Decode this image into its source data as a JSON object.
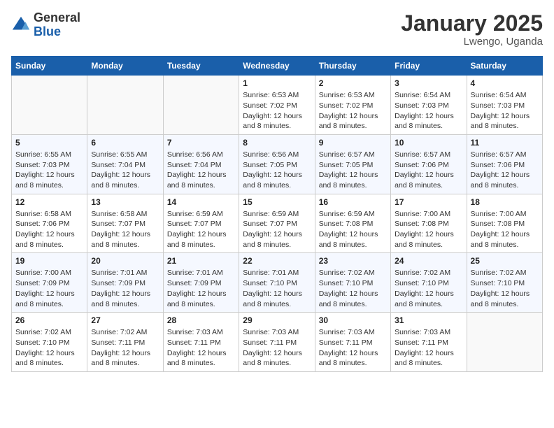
{
  "logo": {
    "general": "General",
    "blue": "Blue"
  },
  "header": {
    "month": "January 2025",
    "location": "Lwengo, Uganda"
  },
  "weekdays": [
    "Sunday",
    "Monday",
    "Tuesday",
    "Wednesday",
    "Thursday",
    "Friday",
    "Saturday"
  ],
  "weeks": [
    [
      {
        "day": "",
        "info": ""
      },
      {
        "day": "",
        "info": ""
      },
      {
        "day": "",
        "info": ""
      },
      {
        "day": "1",
        "info": "Sunrise: 6:53 AM\nSunset: 7:02 PM\nDaylight: 12 hours\nand 8 minutes."
      },
      {
        "day": "2",
        "info": "Sunrise: 6:53 AM\nSunset: 7:02 PM\nDaylight: 12 hours\nand 8 minutes."
      },
      {
        "day": "3",
        "info": "Sunrise: 6:54 AM\nSunset: 7:03 PM\nDaylight: 12 hours\nand 8 minutes."
      },
      {
        "day": "4",
        "info": "Sunrise: 6:54 AM\nSunset: 7:03 PM\nDaylight: 12 hours\nand 8 minutes."
      }
    ],
    [
      {
        "day": "5",
        "info": "Sunrise: 6:55 AM\nSunset: 7:03 PM\nDaylight: 12 hours\nand 8 minutes."
      },
      {
        "day": "6",
        "info": "Sunrise: 6:55 AM\nSunset: 7:04 PM\nDaylight: 12 hours\nand 8 minutes."
      },
      {
        "day": "7",
        "info": "Sunrise: 6:56 AM\nSunset: 7:04 PM\nDaylight: 12 hours\nand 8 minutes."
      },
      {
        "day": "8",
        "info": "Sunrise: 6:56 AM\nSunset: 7:05 PM\nDaylight: 12 hours\nand 8 minutes."
      },
      {
        "day": "9",
        "info": "Sunrise: 6:57 AM\nSunset: 7:05 PM\nDaylight: 12 hours\nand 8 minutes."
      },
      {
        "day": "10",
        "info": "Sunrise: 6:57 AM\nSunset: 7:06 PM\nDaylight: 12 hours\nand 8 minutes."
      },
      {
        "day": "11",
        "info": "Sunrise: 6:57 AM\nSunset: 7:06 PM\nDaylight: 12 hours\nand 8 minutes."
      }
    ],
    [
      {
        "day": "12",
        "info": "Sunrise: 6:58 AM\nSunset: 7:06 PM\nDaylight: 12 hours\nand 8 minutes."
      },
      {
        "day": "13",
        "info": "Sunrise: 6:58 AM\nSunset: 7:07 PM\nDaylight: 12 hours\nand 8 minutes."
      },
      {
        "day": "14",
        "info": "Sunrise: 6:59 AM\nSunset: 7:07 PM\nDaylight: 12 hours\nand 8 minutes."
      },
      {
        "day": "15",
        "info": "Sunrise: 6:59 AM\nSunset: 7:07 PM\nDaylight: 12 hours\nand 8 minutes."
      },
      {
        "day": "16",
        "info": "Sunrise: 6:59 AM\nSunset: 7:08 PM\nDaylight: 12 hours\nand 8 minutes."
      },
      {
        "day": "17",
        "info": "Sunrise: 7:00 AM\nSunset: 7:08 PM\nDaylight: 12 hours\nand 8 minutes."
      },
      {
        "day": "18",
        "info": "Sunrise: 7:00 AM\nSunset: 7:08 PM\nDaylight: 12 hours\nand 8 minutes."
      }
    ],
    [
      {
        "day": "19",
        "info": "Sunrise: 7:00 AM\nSunset: 7:09 PM\nDaylight: 12 hours\nand 8 minutes."
      },
      {
        "day": "20",
        "info": "Sunrise: 7:01 AM\nSunset: 7:09 PM\nDaylight: 12 hours\nand 8 minutes."
      },
      {
        "day": "21",
        "info": "Sunrise: 7:01 AM\nSunset: 7:09 PM\nDaylight: 12 hours\nand 8 minutes."
      },
      {
        "day": "22",
        "info": "Sunrise: 7:01 AM\nSunset: 7:10 PM\nDaylight: 12 hours\nand 8 minutes."
      },
      {
        "day": "23",
        "info": "Sunrise: 7:02 AM\nSunset: 7:10 PM\nDaylight: 12 hours\nand 8 minutes."
      },
      {
        "day": "24",
        "info": "Sunrise: 7:02 AM\nSunset: 7:10 PM\nDaylight: 12 hours\nand 8 minutes."
      },
      {
        "day": "25",
        "info": "Sunrise: 7:02 AM\nSunset: 7:10 PM\nDaylight: 12 hours\nand 8 minutes."
      }
    ],
    [
      {
        "day": "26",
        "info": "Sunrise: 7:02 AM\nSunset: 7:10 PM\nDaylight: 12 hours\nand 8 minutes."
      },
      {
        "day": "27",
        "info": "Sunrise: 7:02 AM\nSunset: 7:11 PM\nDaylight: 12 hours\nand 8 minutes."
      },
      {
        "day": "28",
        "info": "Sunrise: 7:03 AM\nSunset: 7:11 PM\nDaylight: 12 hours\nand 8 minutes."
      },
      {
        "day": "29",
        "info": "Sunrise: 7:03 AM\nSunset: 7:11 PM\nDaylight: 12 hours\nand 8 minutes."
      },
      {
        "day": "30",
        "info": "Sunrise: 7:03 AM\nSunset: 7:11 PM\nDaylight: 12 hours\nand 8 minutes."
      },
      {
        "day": "31",
        "info": "Sunrise: 7:03 AM\nSunset: 7:11 PM\nDaylight: 12 hours\nand 8 minutes."
      },
      {
        "day": "",
        "info": ""
      }
    ]
  ]
}
